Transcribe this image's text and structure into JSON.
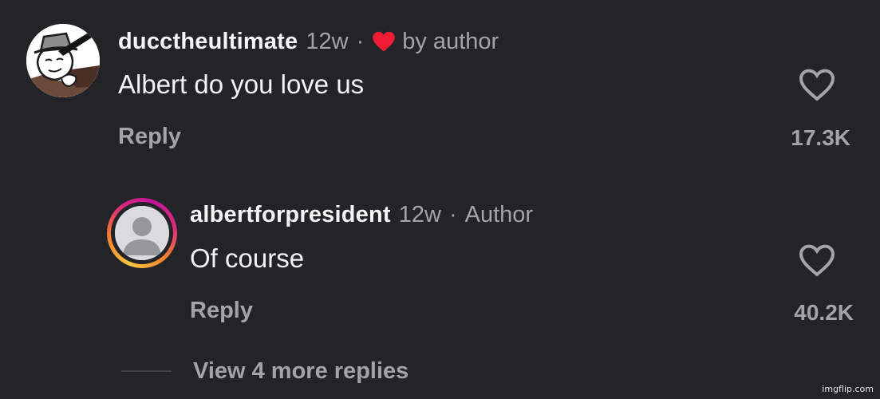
{
  "comment": {
    "username": "ducctheultimate",
    "time": "12w",
    "separator": "·",
    "liked_by": "by author",
    "liked_icon": "red-heart-icon",
    "text": "Albert do you love us",
    "reply_label": "Reply",
    "like_count": "17.3K",
    "like_icon": "heart-outline-icon"
  },
  "reply": {
    "username": "albertforpresident",
    "time": "12w",
    "separator": "·",
    "badge": "Author",
    "text": "Of course",
    "reply_label": "Reply",
    "like_count": "40.2K",
    "like_icon": "heart-outline-icon"
  },
  "view_more": "View 4 more replies",
  "watermark": "imgflip.com",
  "colors": {
    "background": "#232428",
    "primary_text": "#f5f5f5",
    "secondary_text": "#a3a4aa",
    "liked_heart": "#ee1d35"
  }
}
